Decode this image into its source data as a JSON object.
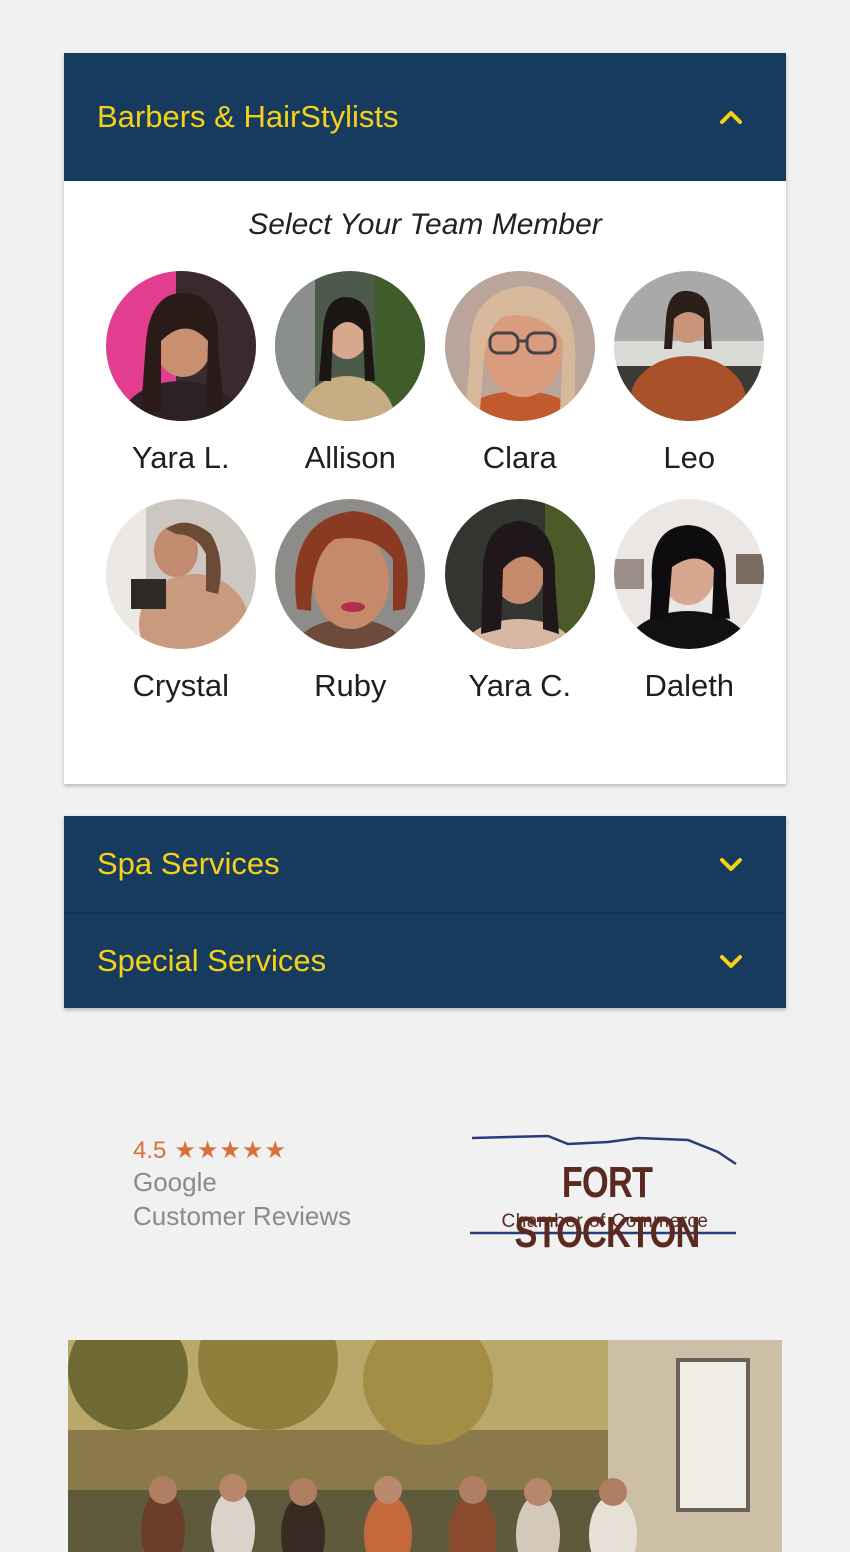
{
  "accordions": [
    {
      "title": "Barbers & HairStylists",
      "expanded": true
    },
    {
      "title": "Spa Services",
      "expanded": false
    },
    {
      "title": "Special Services",
      "expanded": false
    }
  ],
  "team": {
    "heading": "Select Your Team Member",
    "members": [
      {
        "name": "Yara L."
      },
      {
        "name": "Allison"
      },
      {
        "name": "Clara"
      },
      {
        "name": "Leo"
      },
      {
        "name": "Crystal"
      },
      {
        "name": "Ruby"
      },
      {
        "name": "Yara C."
      },
      {
        "name": "Daleth"
      }
    ]
  },
  "reviews": {
    "rating": "4.5",
    "stars": "★★★★★",
    "line1": "Google",
    "line2": "Customer Reviews"
  },
  "chamber": {
    "name": "FORT STOCKTON",
    "subtitle": "Chamber of Commerce"
  },
  "colors": {
    "header_bg": "#173b5f",
    "header_text": "#f7d117",
    "page_bg": "#f1f1f1"
  }
}
